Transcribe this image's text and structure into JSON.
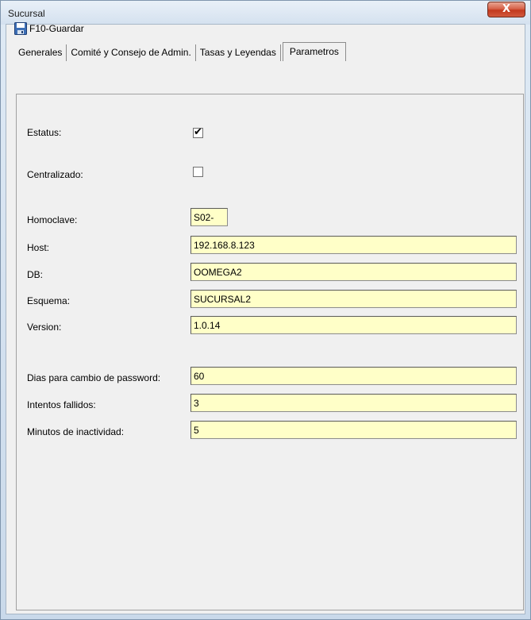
{
  "window": {
    "title": "Sucursal",
    "close_glyph": "X"
  },
  "toolbar": {
    "save_label": "F10-Guardar",
    "save_icon": "floppy-disk-icon"
  },
  "tabs": [
    {
      "label": "Generales",
      "active": false
    },
    {
      "label": "Comité y Consejo de Admin.",
      "active": false
    },
    {
      "label": "Tasas y Leyendas",
      "active": false
    },
    {
      "label": "Parametros",
      "active": true
    }
  ],
  "form": {
    "estatus": {
      "label": "Estatus:",
      "checked": true,
      "tick": "✔"
    },
    "centralizado": {
      "label": "Centralizado:",
      "checked": false
    },
    "homoclave": {
      "label": "Homoclave:",
      "value": "S02-"
    },
    "host": {
      "label": "Host:",
      "value": "192.168.8.123"
    },
    "db": {
      "label": "DB:",
      "value": "OOMEGA2"
    },
    "esquema": {
      "label": "Esquema:",
      "value": "SUCURSAL2"
    },
    "version": {
      "label": "Version:",
      "value": "1.0.14"
    },
    "dias_password": {
      "label": "Dias para cambio de password:",
      "value": "60"
    },
    "intentos": {
      "label": "Intentos fallidos:",
      "value": "3"
    },
    "minutos": {
      "label": "Minutos de inactividad:",
      "value": "5"
    }
  },
  "colors": {
    "input_bg": "#ffffc8",
    "panel_bg": "#f0f0f0",
    "close_button": "#c2391e"
  }
}
